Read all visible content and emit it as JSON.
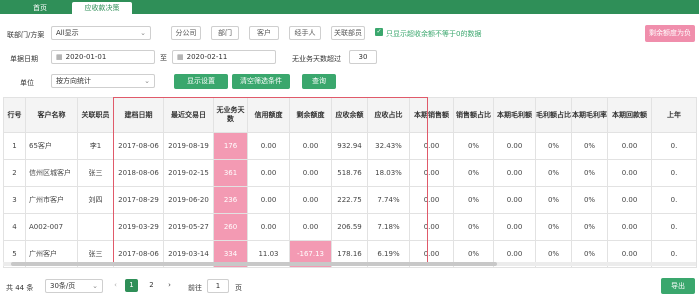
{
  "tabs": [
    {
      "label": "首页"
    },
    {
      "label": "应收款决策"
    }
  ],
  "filters": {
    "dept_label": "联部门/方案",
    "dept_value": "All显示",
    "btn_unit": "分公司",
    "btn_dept": "部门",
    "btn_client": "客户",
    "btn_handler": "经手人",
    "btn_link": "关联部员",
    "only_show_label": "只显示超收余额不等于0的数据",
    "days_label": "单据日期",
    "date_from": "2020-01-01",
    "date_to_sep": "至",
    "date_to": "2020-02-11",
    "noreceive_days_label": "无业务天数超过",
    "noreceive_days": "30",
    "unit_label": "单位",
    "unit_value": "按方向统计",
    "btn_display": "显示设置",
    "btn_clear": "清空筛选条件",
    "btn_query": "查询",
    "btn_pink": "剩余额度为负"
  },
  "table": {
    "headers": [
      "行号",
      "客户名称",
      "关联职员",
      "建档日期",
      "最近交易日",
      "无业务天数",
      "信用额度",
      "剩余额度",
      "应收余额",
      "应收占比",
      "本期销售额",
      "销售额占比",
      "本期毛利额",
      "毛利额占比",
      "本期毛利率",
      "本期回款额",
      "上年"
    ],
    "rows": [
      [
        "1",
        "65客户",
        "李1",
        "2017-08-06",
        "2019-08-19",
        "176",
        "0.00",
        "0.00",
        "932.94",
        "32.43%",
        "0.00",
        "0%",
        "0.00",
        "0%",
        "0%",
        "0.00",
        "0."
      ],
      [
        "2",
        "信州区城客户",
        "张三",
        "2018-08-06",
        "2019-02-15",
        "361",
        "0.00",
        "0.00",
        "518.76",
        "18.03%",
        "0.00",
        "0%",
        "0.00",
        "0%",
        "0%",
        "0.00",
        "0."
      ],
      [
        "3",
        "广州市客户",
        "刘四",
        "2017-08-29",
        "2019-06-20",
        "236",
        "0.00",
        "0.00",
        "222.75",
        "7.74%",
        "0.00",
        "0%",
        "0.00",
        "0%",
        "0%",
        "0.00",
        "0."
      ],
      [
        "4",
        "A002-007",
        "",
        "2019-03-29",
        "2019-05-27",
        "260",
        "0.00",
        "0.00",
        "206.59",
        "7.18%",
        "0.00",
        "0%",
        "0.00",
        "0%",
        "0%",
        "0.00",
        "0."
      ],
      [
        "5",
        "广州客户",
        "张三",
        "2017-08-06",
        "2019-03-14",
        "334",
        "11.03",
        "-167.13",
        "178.16",
        "6.19%",
        "0.00",
        "0%",
        "0.00",
        "0%",
        "0%",
        "0.00",
        "0."
      ]
    ]
  },
  "footer": {
    "total": "共 44 条",
    "page_size": "30条/页",
    "prev": "‹",
    "page1": "1",
    "page2": "2",
    "next": "›",
    "goto_label": "前往",
    "goto_value": "1",
    "goto_suffix": "页",
    "export": "导出"
  },
  "colors": {
    "primary": "#2f8f58",
    "accent": "#3aa76d",
    "highlight": "#f39ab3",
    "frame": "#e05a6a"
  }
}
